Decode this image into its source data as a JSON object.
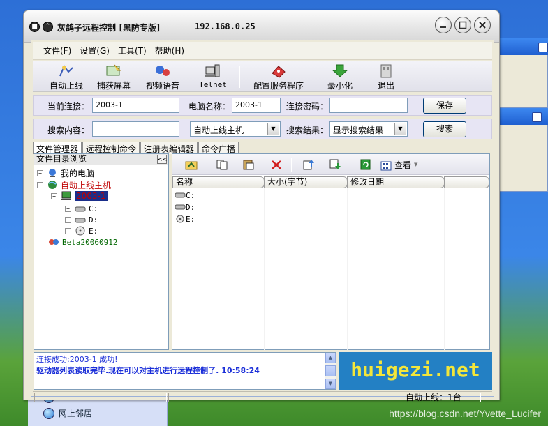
{
  "window": {
    "title": "灰鸽子远程控制 [黑防专版]",
    "ip": "192.168.0.25"
  },
  "menu": [
    "文件(F)",
    "设置(G)",
    "工具(T)",
    "帮助(H)"
  ],
  "toolbar": [
    {
      "label": "自动上线",
      "icon": "auto-online-icon"
    },
    {
      "label": "捕获屏幕",
      "icon": "capture-screen-icon"
    },
    {
      "label": "视频语音",
      "icon": "video-voice-icon"
    },
    {
      "label": "Telnet",
      "icon": "telnet-icon"
    },
    {
      "label": "配置服务程序",
      "icon": "configure-server-icon"
    },
    {
      "label": "最小化",
      "icon": "minimize-icon"
    },
    {
      "label": "退出",
      "icon": "exit-icon"
    }
  ],
  "connection": {
    "current_label": "当前连接：",
    "current_value": "2003-1",
    "pcname_label": "电脑名称：",
    "pcname_value": "2003-1",
    "password_label": "连接密码：",
    "password_value": "",
    "save_label": "保存"
  },
  "search": {
    "content_label": "搜索内容：",
    "content_value": "",
    "scope_value": "自动上线主机",
    "result_label": "搜索结果：",
    "result_value": "显示搜索结果",
    "button_label": "搜索"
  },
  "tabs": [
    "文件管理器",
    "远程控制命令",
    "注册表编辑器",
    "命令广播"
  ],
  "tree": {
    "header": "文件目录浏览",
    "nodes": [
      {
        "label": "我的电脑",
        "color": "#000000"
      },
      {
        "label": "自动上线主机",
        "color": "#c00000"
      },
      {
        "label": "2003-1",
        "color": "#c00000"
      },
      {
        "label": "C:",
        "color": "#000000"
      },
      {
        "label": "D:",
        "color": "#000000"
      },
      {
        "label": "E:",
        "color": "#000000"
      },
      {
        "label": "Beta20060912",
        "color": "#006600"
      }
    ]
  },
  "filelist": {
    "view_label": "查看",
    "columns": [
      "名称",
      "大小(字节)",
      "修改日期"
    ],
    "rows": [
      {
        "name": "C:",
        "size": "",
        "date": ""
      },
      {
        "name": "D:",
        "size": "",
        "date": ""
      },
      {
        "name": "E:",
        "size": "",
        "date": ""
      }
    ]
  },
  "log": {
    "line1": "连接成功:2003-1 成功!",
    "line2": "驱动器列表读取完毕.现在可以对主机进行远程控制了.  10:58:24"
  },
  "banner": "huigezi.net",
  "statusbar": {
    "online": "自动上线：1台"
  },
  "desktop": {
    "item": "网上邻居",
    "watermark": "https://blog.csdn.net/Yvette_Lucifer"
  },
  "colors": {
    "banner_bg": "#2380c4",
    "banner_text": "#f3e63a",
    "log_text": "#1a2ed8",
    "node_online": "#c00000"
  }
}
